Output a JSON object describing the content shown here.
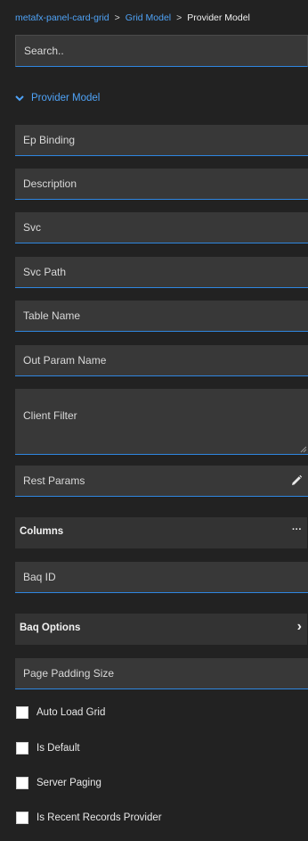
{
  "breadcrumb": {
    "root": "metafx-panel-card-grid",
    "middle": "Grid Model",
    "current": "Provider Model",
    "separator": ">"
  },
  "search": {
    "placeholder": "Search.."
  },
  "section": {
    "title": "Provider Model"
  },
  "fields": {
    "ep_binding": "Ep Binding",
    "description": "Description",
    "svc": "Svc",
    "svc_path": "Svc Path",
    "table_name": "Table Name",
    "out_param_name": "Out Param Name",
    "client_filter": "Client Filter",
    "rest_params": "Rest Params",
    "baq_id": "Baq ID",
    "page_padding_size": "Page Padding Size"
  },
  "panels": {
    "columns": "Columns",
    "columns_menu": "···",
    "baq_options": "Baq Options",
    "baq_options_arrow": "›"
  },
  "checkboxes": {
    "auto_load_grid": "Auto Load Grid",
    "is_default": "Is Default",
    "server_paging": "Server Paging",
    "is_recent_records_provider": "Is Recent Records Provider"
  },
  "colors": {
    "background": "#222222",
    "field": "#383838",
    "accent": "#2f86e0",
    "link": "#4fa3f7"
  }
}
